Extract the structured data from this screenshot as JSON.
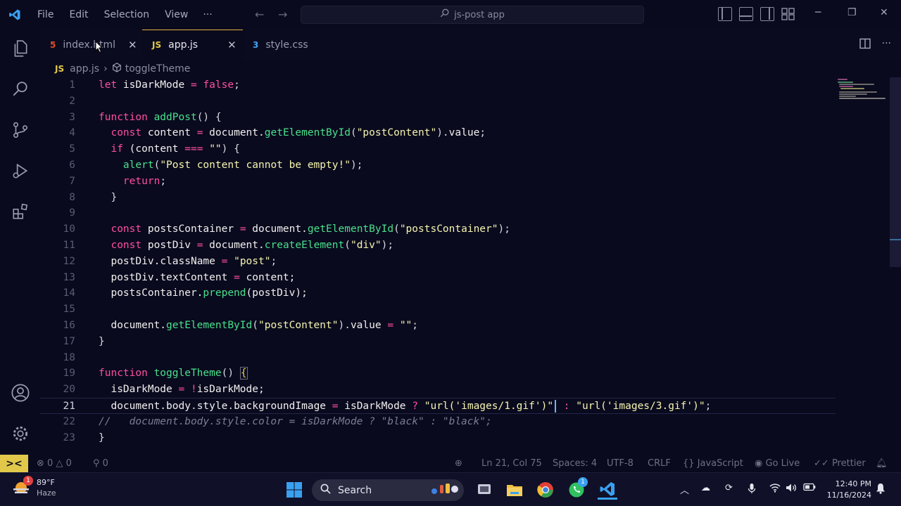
{
  "titlebar": {
    "menu": [
      "File",
      "Edit",
      "Selection",
      "View"
    ],
    "more": "···",
    "search_text": "js-post app"
  },
  "tabs": [
    {
      "label": "index.html",
      "icon": "html5-icon",
      "icon_text": "5",
      "icon_color": "#e44d26",
      "active": false
    },
    {
      "label": "app.js",
      "icon": "js-icon",
      "icon_text": "JS",
      "icon_color": "#e2c84a",
      "active": true
    },
    {
      "label": "style.css",
      "icon": "css3-icon",
      "icon_text": "3",
      "icon_color": "#42a5f5",
      "active": false
    }
  ],
  "breadcrumb": {
    "file_badge": "JS",
    "file": "app.js",
    "sep": "›",
    "symbol": "toggleTheme"
  },
  "editor": {
    "current_line": 21,
    "lines": [
      {
        "n": "1"
      },
      {
        "n": "2"
      },
      {
        "n": "3"
      },
      {
        "n": "4"
      },
      {
        "n": "5"
      },
      {
        "n": "6"
      },
      {
        "n": "7"
      },
      {
        "n": "8"
      },
      {
        "n": "9"
      },
      {
        "n": "10"
      },
      {
        "n": "11"
      },
      {
        "n": "12"
      },
      {
        "n": "13"
      },
      {
        "n": "14"
      },
      {
        "n": "15"
      },
      {
        "n": "16"
      },
      {
        "n": "17"
      },
      {
        "n": "18"
      },
      {
        "n": "19"
      },
      {
        "n": "20"
      },
      {
        "n": "21"
      },
      {
        "n": "22"
      },
      {
        "n": "23"
      }
    ],
    "code": {
      "l1": [
        "let",
        " isDarkMode ",
        "=",
        " ",
        "false",
        ";"
      ],
      "l3": [
        "function",
        " ",
        "addPost",
        "() {"
      ],
      "l4": [
        "  ",
        "const",
        " content ",
        "=",
        " document.",
        "getElementById",
        "(",
        "\"postContent\"",
        ").",
        "value",
        ";"
      ],
      "l5": [
        "  ",
        "if",
        " (content ",
        "===",
        " ",
        "\"\"",
        ") {"
      ],
      "l6": [
        "    ",
        "alert",
        "(",
        "\"Post content cannot be empty!\"",
        ");"
      ],
      "l7": [
        "    ",
        "return",
        ";"
      ],
      "l8": [
        "  }"
      ],
      "l10": [
        "  ",
        "const",
        " postsContainer ",
        "=",
        " document.",
        "getElementById",
        "(",
        "\"postsContainer\"",
        ");"
      ],
      "l11": [
        "  ",
        "const",
        " postDiv ",
        "=",
        " document.",
        "createElement",
        "(",
        "\"div\"",
        ");"
      ],
      "l12": [
        "  postDiv.",
        "className",
        " ",
        "=",
        " ",
        "\"post\"",
        ";"
      ],
      "l13": [
        "  postDiv.",
        "textContent",
        " ",
        "=",
        " content;"
      ],
      "l14": [
        "  postsContainer.",
        "prepend",
        "(postDiv);"
      ],
      "l16": [
        "  document.",
        "getElementById",
        "(",
        "\"postContent\"",
        ").",
        "value",
        " ",
        "=",
        " ",
        "\"\"",
        ";"
      ],
      "l17": [
        "}"
      ],
      "l19": [
        "function",
        " ",
        "toggleTheme",
        "() ",
        "{"
      ],
      "l20": [
        "  isDarkMode ",
        "=",
        " ",
        "!",
        "isDarkMode;"
      ],
      "l21": [
        "  document.",
        "body",
        ".",
        "style",
        ".",
        "backgroundImage",
        " ",
        "=",
        " isDarkMode ",
        "?",
        " ",
        "\"url('images/1.gif')\"",
        " ",
        ":",
        " ",
        "\"url('images/3.gif')\"",
        ";"
      ],
      "l22": [
        "//   document.body.style.color = isDarkMode ? \"black\" : \"black\";"
      ],
      "l23": [
        "}"
      ]
    }
  },
  "statusbar": {
    "remote": "><",
    "errors": "0",
    "warnings": "0",
    "ports": "0",
    "position": "Ln 21, Col 75",
    "spaces": "Spaces: 4",
    "encoding": "UTF-8",
    "eol": "CRLF",
    "language": "JavaScript",
    "golive": "Go Live",
    "prettier": "Prettier"
  },
  "taskbar": {
    "weather_temp": "89°F",
    "weather_desc": "Haze",
    "weather_badge": "1",
    "search_label": "Search",
    "whatsapp_badge": "1",
    "time": "12:40 PM",
    "date": "11/16/2024"
  },
  "colors": {
    "accent": "#e2c84a",
    "keyword": "#ff4fa3",
    "function": "#49e08c",
    "string": "#f5f5b0",
    "background": "#0a0a1e"
  }
}
